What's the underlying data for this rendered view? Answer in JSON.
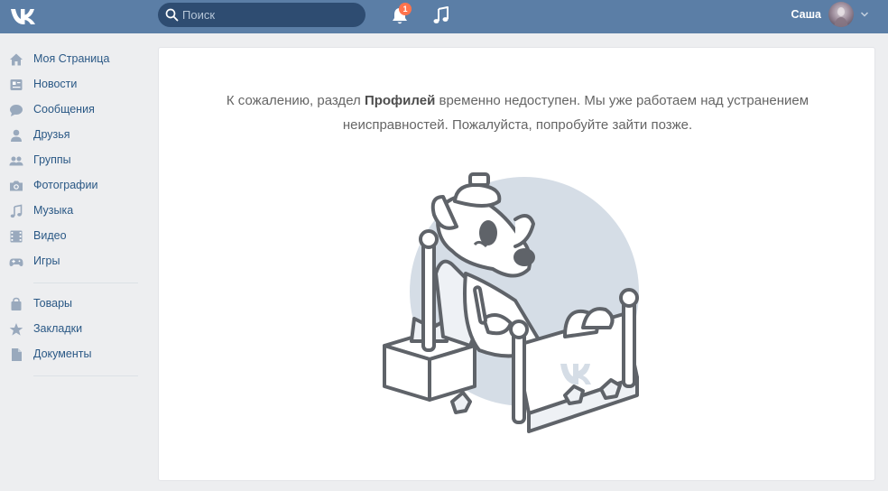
{
  "header": {
    "logo": "vk-logo",
    "search": {
      "placeholder": "Поиск",
      "value": ""
    },
    "notifications": {
      "count": "1"
    },
    "user": {
      "name": "Саша"
    }
  },
  "sidebar": {
    "items": [
      {
        "label": "Моя Страница",
        "icon": "home-icon"
      },
      {
        "label": "Новости",
        "icon": "news-icon"
      },
      {
        "label": "Сообщения",
        "icon": "messages-icon"
      },
      {
        "label": "Друзья",
        "icon": "friends-icon"
      },
      {
        "label": "Группы",
        "icon": "groups-icon"
      },
      {
        "label": "Фотографии",
        "icon": "camera-icon"
      },
      {
        "label": "Музыка",
        "icon": "music-note-icon"
      },
      {
        "label": "Видео",
        "icon": "video-icon"
      },
      {
        "label": "Игры",
        "icon": "gamepad-icon"
      }
    ],
    "extra_items": [
      {
        "label": "Товары",
        "icon": "bag-icon"
      },
      {
        "label": "Закладки",
        "icon": "star-icon"
      },
      {
        "label": "Документы",
        "icon": "document-icon"
      }
    ]
  },
  "main": {
    "message_before": "К сожалению, раздел ",
    "message_section": "Профилей",
    "message_after": " временно недоступен. Мы уже работаем над устранением неисправностей. Пожалуйста, попробуйте зайти позже.",
    "illustration": "sick-dog-in-bed-illustration"
  },
  "colors": {
    "header_bg": "#5b7ea6",
    "search_bg": "#2e4c71",
    "link": "#2a5885",
    "icon": "#99a9bd",
    "badge": "#ff734c",
    "page_bg": "#edeef0"
  }
}
